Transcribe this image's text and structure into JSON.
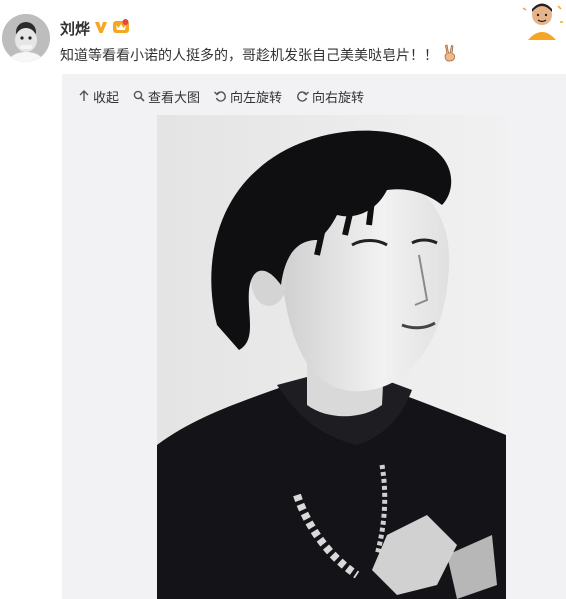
{
  "post": {
    "author_name": "刘烨",
    "text": "知道等看看小诺的人挺多的，哥趁机发张自己美美哒皂片！！",
    "emoji_icon": "victory-hand-icon"
  },
  "media": {
    "toolbar": {
      "collapse_label": "收起",
      "view_large_label": "查看大图",
      "rotate_left_label": "向左旋转",
      "rotate_right_label": "向右旋转"
    }
  },
  "colors": {
    "verified_badge": "#f5a623",
    "text": "#333333",
    "card_bg": "#f2f2f5"
  }
}
